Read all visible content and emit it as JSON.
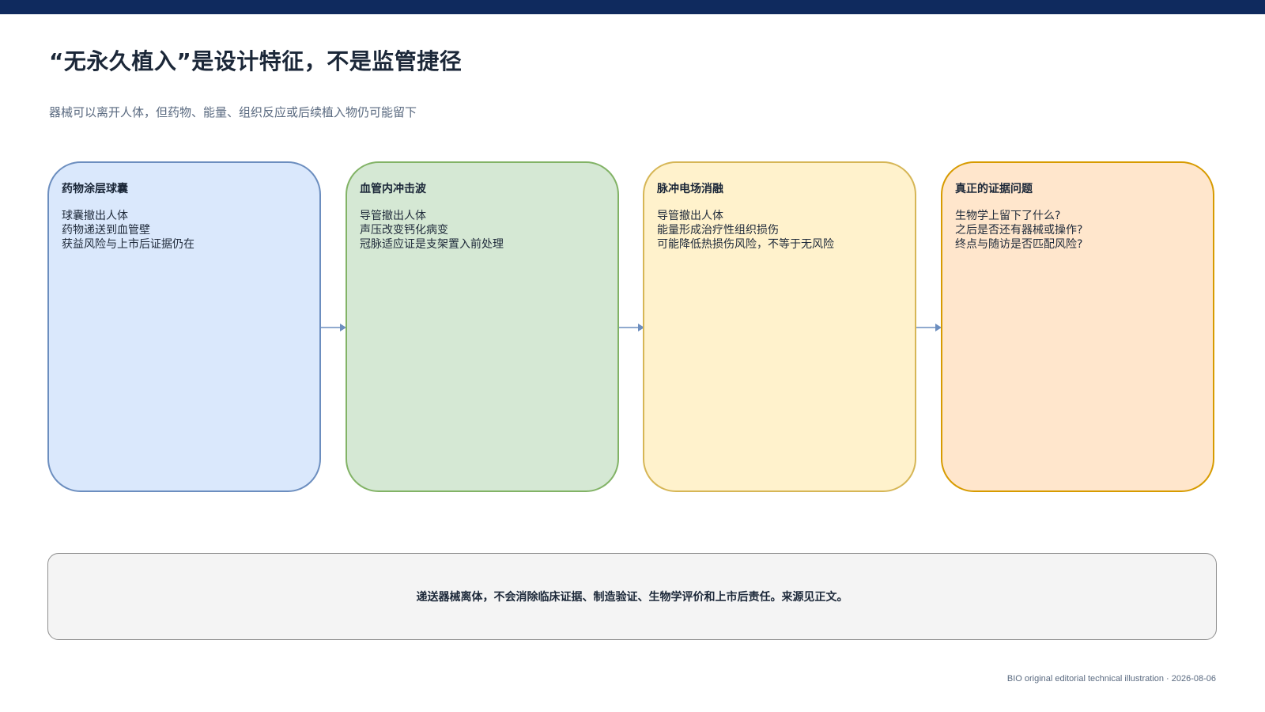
{
  "header": {
    "title": "“无永久植入”是设计特征，不是监管捷径",
    "subtitle": "器械可以离开人体，但药物、能量、组织反应或后续植入物仍可能留下"
  },
  "cards": [
    {
      "title": "药物涂层球囊",
      "lines": [
        "球囊撤出人体",
        "药物递送到血管壁",
        "获益风险与上市后证据仍在"
      ],
      "fill": "#dae8fc",
      "stroke": "#6c8ebf"
    },
    {
      "title": "血管内冲击波",
      "lines": [
        "导管撤出人体",
        "声压改变钙化病变",
        "冠脉适应证是支架置入前处理"
      ],
      "fill": "#d5e8d4",
      "stroke": "#82b366"
    },
    {
      "title": "脉冲电场消融",
      "lines": [
        "导管撤出人体",
        "能量形成治疗性组织损伤",
        "可能降低热损伤风险，不等于无风险"
      ],
      "fill": "#fff2cc",
      "stroke": "#d6b656"
    },
    {
      "title": "真正的证据问题",
      "lines": [
        "生物学上留下了什么?",
        "之后是否还有器械或操作?",
        "终点与随访是否匹配风险?"
      ],
      "fill": "#ffe6cc",
      "stroke": "#d79b00"
    }
  ],
  "connector_color": "#6c8ebf",
  "summary": "递送器械离体，不会消除临床证据、制造验证、生物学评价和上市后责任。来源见正文。",
  "footer": "BIO original editorial technical illustration · 2026-08-06",
  "accent_bar_color": "#0f2a5e"
}
